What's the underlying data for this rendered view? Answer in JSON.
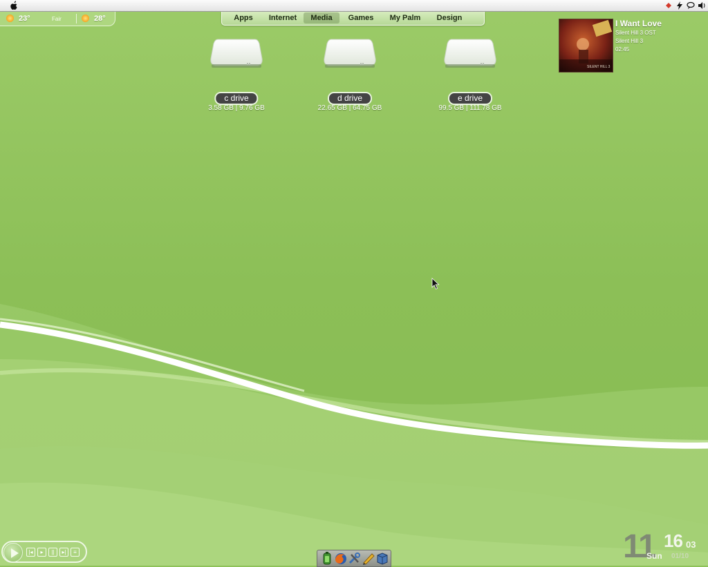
{
  "colors": {
    "background": "#8fc25a",
    "swoosh": "#ffffff",
    "label_bg": "#444444"
  },
  "menubar": {
    "apple_icon": "apple-logo-icon",
    "tray_icons": [
      "wifi-tag-icon",
      "power-bolt-icon",
      "chat-bubble-icon",
      "speaker-icon"
    ]
  },
  "weather": {
    "current_temp": "23°",
    "condition": "Fair",
    "forecast_temp": "28°"
  },
  "launcher": {
    "tabs": [
      {
        "label": "Apps"
      },
      {
        "label": "Internet"
      },
      {
        "label": "Media",
        "active": true
      },
      {
        "label": "Games"
      },
      {
        "label": "My Palm"
      },
      {
        "label": "Design"
      }
    ]
  },
  "drives": [
    {
      "label": "c drive",
      "usage": "3.58 GB | 9.76 GB"
    },
    {
      "label": "d drive",
      "usage": "22.65 GB | 64.75 GB"
    },
    {
      "label": "e drive",
      "usage": "99.5 GB | 111.78 GB"
    }
  ],
  "now_playing": {
    "title": "I Want Love",
    "album": "Silent Hill 3 OST",
    "artist": "Silent Hill 3",
    "time": "02:45",
    "cover_text": "SILENT HILL 3"
  },
  "player": {
    "controls": [
      "previous-icon",
      "play-icon",
      "pause-icon",
      "next-icon",
      "playlist-icon"
    ]
  },
  "dock": {
    "items": [
      "battery-icon",
      "firefox-icon",
      "tools-icon",
      "pencil-icon",
      "box-icon"
    ]
  },
  "clock": {
    "hour": "11",
    "minute": "16",
    "second": "03",
    "day": "Sun",
    "date": "01/10"
  }
}
